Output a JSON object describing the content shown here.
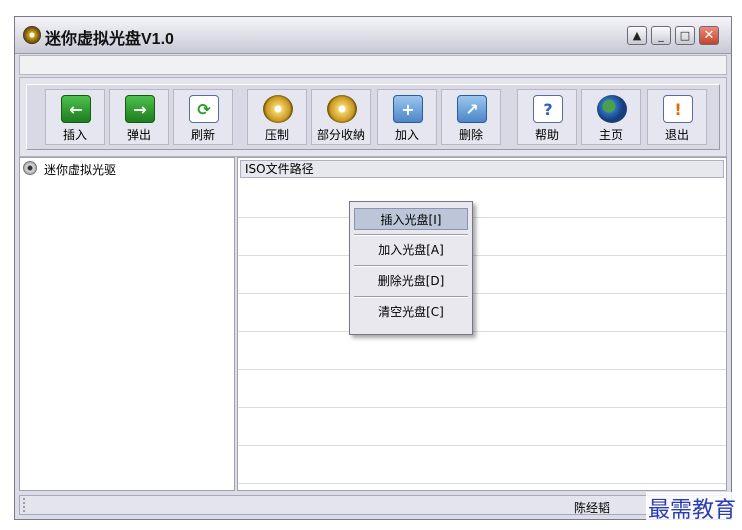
{
  "window": {
    "title": "迷你虚拟光盘V1.0",
    "controls": {
      "up": "▲",
      "minimize": "_",
      "maximize": "□",
      "close": "✕"
    }
  },
  "toolbar": {
    "buttons": [
      {
        "label": "插入",
        "icon": "insert-icon",
        "glyph": "←"
      },
      {
        "label": "弹出",
        "icon": "eject-icon",
        "glyph": "→"
      },
      {
        "label": "刷新",
        "icon": "refresh-icon",
        "glyph": "⟳"
      },
      {
        "label": "压制",
        "icon": "compress-icon",
        "glyph": ""
      },
      {
        "label": "部分收納",
        "icon": "partial-collect-icon",
        "glyph": ""
      },
      {
        "label": "加入",
        "icon": "add-folder-icon",
        "glyph": "+"
      },
      {
        "label": "删除",
        "icon": "delete-folder-icon",
        "glyph": "↗"
      },
      {
        "label": "帮助",
        "icon": "help-icon",
        "glyph": "?"
      },
      {
        "label": "主页",
        "icon": "home-globe-icon",
        "glyph": ""
      },
      {
        "label": "退出",
        "icon": "exit-icon",
        "glyph": "!"
      }
    ]
  },
  "tree": {
    "root_label": "迷你虚拟光驱"
  },
  "list": {
    "column_header": "ISO文件路径"
  },
  "context_menu": {
    "items": [
      {
        "label": "插入光盘[I]",
        "selected": true
      },
      {
        "label": "加入光盘[A]",
        "selected": false
      },
      {
        "label": "删除光盘[D]",
        "selected": false
      },
      {
        "label": "清空光盘[C]",
        "selected": false
      }
    ]
  },
  "status": {
    "right_text": "陈经韬"
  },
  "watermark": "最需教育"
}
